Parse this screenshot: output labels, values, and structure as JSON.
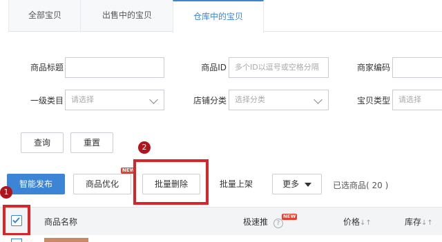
{
  "tabs": [
    "全部宝贝",
    "出售中的宝贝",
    "仓库中的宝贝"
  ],
  "filters": {
    "title_label": "商品标题",
    "id_label": "商品ID",
    "id_placeholder": "多个ID以逗号或空格分隔",
    "merchant_code_label": "商家编码",
    "category_label": "一级类目",
    "category_placeholder": "请选择",
    "shop_category_label": "店铺分类",
    "shop_category_placeholder": "选择分类",
    "item_type_label": "宝贝类型",
    "item_type_placeholder": "请选择"
  },
  "search_buttons": {
    "query": "查询",
    "reset": "重置"
  },
  "actions": {
    "smart_publish": "智能发布",
    "optimize": "商品优化",
    "batch_delete": "批量删除",
    "batch_list": "批量上架",
    "more": "更多",
    "selected_text": "已选商品( 20 )",
    "new_badge": "NEW"
  },
  "annotations": {
    "step1": "1",
    "step2": "2"
  },
  "table": {
    "headers": {
      "name": "商品名称",
      "promo": "极速推",
      "price": "价格",
      "stock": "库存"
    },
    "promo_new": "NEW",
    "help_glyph": "?",
    "sort_glyph": "↓↑"
  },
  "colors": {
    "accent": "#3c84d6",
    "annotation_red": "#d7252a"
  }
}
